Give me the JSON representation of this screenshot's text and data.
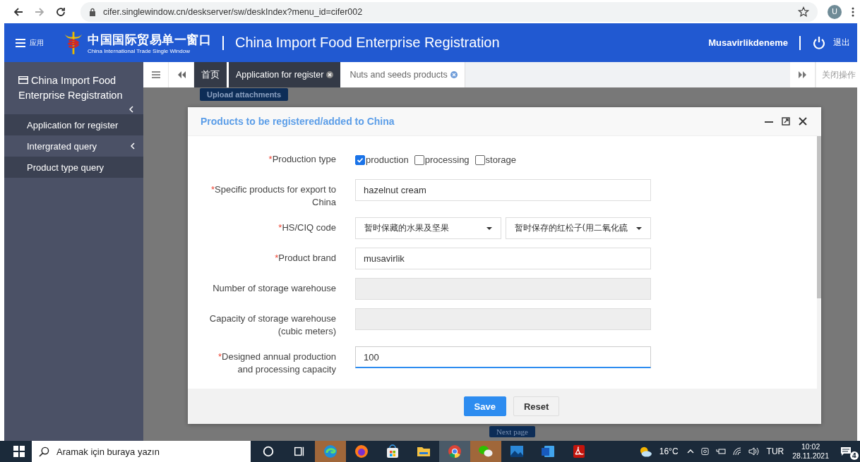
{
  "browser": {
    "url": "cifer.singlewindow.cn/deskserver/sw/deskIndex?menu_id=cifer002",
    "avatar": "U"
  },
  "header": {
    "menu_label": "应用",
    "logo_cn": "中国国际贸易单一窗口",
    "logo_en": "China International Trade Single Window",
    "title": "China Import Food Enterprise Registration",
    "user": "Musavirlikdeneme",
    "logout": "退出"
  },
  "sidebar": {
    "title": "China Import Food Enterprise Registration",
    "items": [
      {
        "label": "Application for register",
        "selected": true,
        "submenu": false
      },
      {
        "label": "Intergrated query",
        "selected": false,
        "submenu": true
      },
      {
        "label": "Product type query",
        "selected": true,
        "submenu": false
      }
    ]
  },
  "tabs": [
    {
      "label": "首页",
      "selected": true,
      "closable": false
    },
    {
      "label": "Application for register",
      "selected": true,
      "closable": true
    },
    {
      "label": "Nuts and seeds products",
      "selected": false,
      "closable": true
    }
  ],
  "tab_actions": "关闭操作",
  "page": {
    "upload_button": "Upload attachments",
    "next_button": "Next page"
  },
  "dialog": {
    "title": "Products to be registered/added to China",
    "fields": [
      {
        "kind": "checkboxes",
        "required_mark": "*",
        "label": "Production type",
        "options": [
          {
            "label": "production",
            "checked": true
          },
          {
            "label": "processing",
            "checked": false
          },
          {
            "label": "storage",
            "checked": false
          }
        ]
      },
      {
        "kind": "text",
        "required_mark": "*",
        "label": "Specific products for export to China",
        "value": "hazelnut cream",
        "disabled": false,
        "focused": false
      },
      {
        "kind": "selects",
        "required_mark": "*",
        "label": "HS/CIQ code",
        "values": [
          "暂时保藏的水果及坚果",
          "暂时保存的红松子(用二氧化硫"
        ]
      },
      {
        "kind": "text",
        "required_mark": "*",
        "label": "Product brand",
        "value": "musavirlik",
        "disabled": false,
        "focused": false
      },
      {
        "kind": "text",
        "label": "Number of storage warehouse",
        "disabled": true,
        "focused": false
      },
      {
        "kind": "text",
        "label": "Capacity of storage warehouse (cubic meters)",
        "disabled": true,
        "focused": false
      },
      {
        "kind": "text",
        "required_mark": "*",
        "label": "Designed annual production and processing capacity",
        "value": "100",
        "disabled": false,
        "focused": true
      }
    ],
    "buttons": [
      {
        "label": "Save",
        "primary": true
      },
      {
        "label": "Reset",
        "primary": false
      }
    ]
  },
  "taskbar": {
    "search_placeholder": "Aramak için buraya yazın",
    "apps": [
      {
        "kind": "cortana",
        "active": false,
        "highlight": false
      },
      {
        "kind": "taskview",
        "active": false,
        "highlight": false
      },
      {
        "kind": "edge",
        "active": false,
        "highlight": true
      },
      {
        "kind": "firefox",
        "active": false,
        "highlight": false
      },
      {
        "kind": "store",
        "active": false,
        "highlight": false
      },
      {
        "kind": "files",
        "active": false,
        "highlight": false
      },
      {
        "kind": "chrome",
        "active": true,
        "highlight": false
      },
      {
        "kind": "wechat",
        "active": false,
        "highlight": true
      },
      {
        "kind": "photos",
        "active": false,
        "highlight": false
      },
      {
        "kind": "word",
        "active": false,
        "highlight": false
      },
      {
        "kind": "pdf",
        "active": false,
        "highlight": false
      }
    ],
    "temperature": "16°C",
    "language": "TUR",
    "time": "10:02",
    "date": "28.11.2021",
    "notifications": "4"
  }
}
